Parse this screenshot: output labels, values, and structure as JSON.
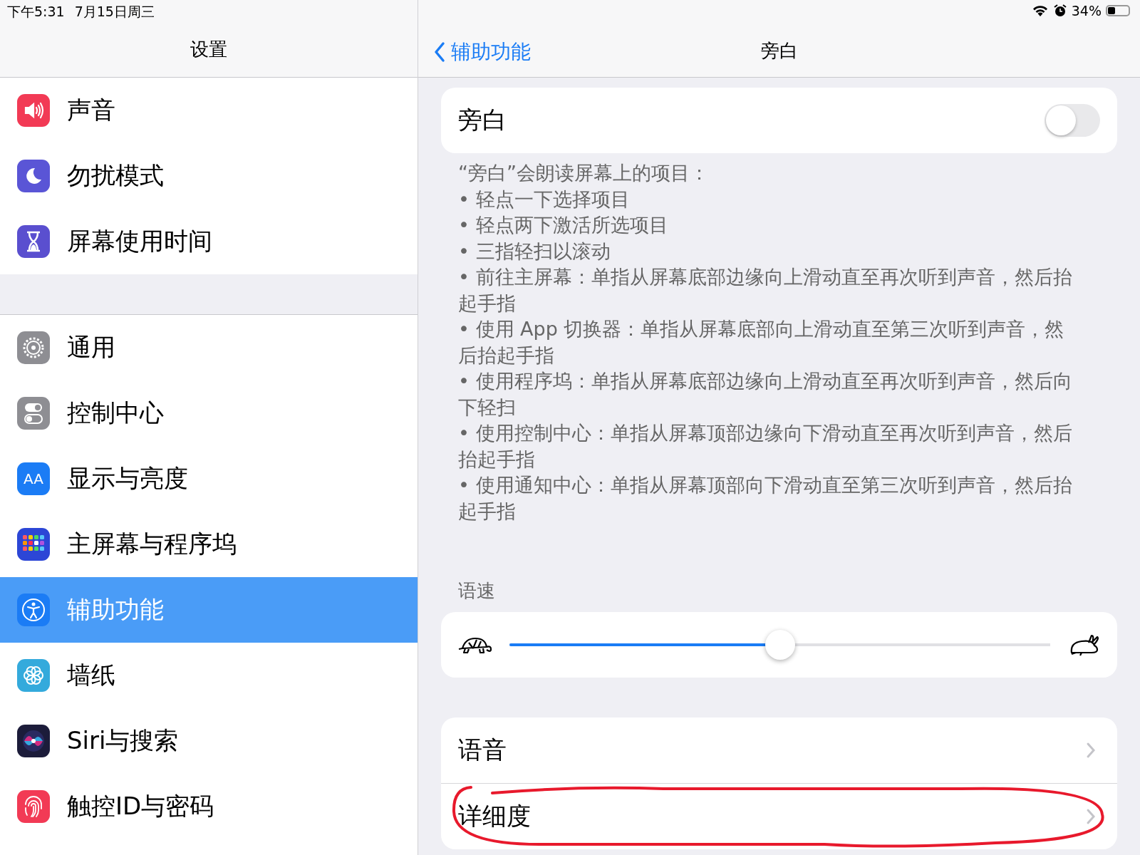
{
  "status_bar": {
    "time": "下午5:31",
    "date": "7月15日周三",
    "battery_text": "34%"
  },
  "sidebar": {
    "title": "设置",
    "groups": [
      [
        {
          "label": "声音",
          "kind": "speaker",
          "color": "#f23a55",
          "selected": false
        },
        {
          "label": "勿扰模式",
          "kind": "moon",
          "color": "#5a55d6",
          "selected": false
        },
        {
          "label": "屏幕使用时间",
          "kind": "hourglass",
          "color": "#5a4fcf",
          "selected": false
        }
      ],
      [
        {
          "label": "通用",
          "kind": "gear",
          "color": "#8e8e93",
          "selected": false
        },
        {
          "label": "控制中心",
          "kind": "toggles",
          "color": "#8e8e93",
          "selected": false
        },
        {
          "label": "显示与亮度",
          "kind": "text",
          "icon_text": "AA",
          "color": "#1b7cf5",
          "selected": false
        },
        {
          "label": "主屏幕与程序坞",
          "kind": "grid",
          "color": "#2c46d6",
          "selected": false
        },
        {
          "label": "辅助功能",
          "kind": "person",
          "color": "#1b7cf5",
          "selected": true
        },
        {
          "label": "墙纸",
          "kind": "flower",
          "color": "#34aadc",
          "selected": false
        },
        {
          "label": "Siri与搜索",
          "kind": "orb",
          "color": "#1c1c3a",
          "selected": false
        },
        {
          "label": "触控ID与密码",
          "kind": "fingerprint",
          "color": "#f23a55",
          "selected": false
        }
      ]
    ]
  },
  "detail": {
    "back_label": "辅助功能",
    "title": "旁白"
  },
  "voiceover": {
    "label": "旁白",
    "on": false
  },
  "description": [
    "“旁白”会朗读屏幕上的项目：",
    "• 轻点一下选择项目",
    "• 轻点两下激活所选项目",
    "• 三指轻扫以滚动",
    "• 前往主屏幕：单指从屏幕底部边缘向上滑动直至再次听到声音，然后抬起手指",
    "• 使用 App 切换器：单指从屏幕底部向上滑动直至第三次听到声音，然后抬起手指",
    "• 使用程序坞：单指从屏幕底部边缘向上滑动直至再次听到声音，然后向下轻扫",
    "• 使用控制中心：单指从屏幕顶部边缘向下滑动直至再次听到声音，然后抬起手指",
    "• 使用通知中心：单指从屏幕顶部向下滑动直至第三次听到声音，然后抬起手指"
  ],
  "speech_rate": {
    "label": "语速",
    "level": 0.5
  },
  "options": [
    {
      "label": "语音"
    },
    {
      "label": "详细度"
    }
  ]
}
